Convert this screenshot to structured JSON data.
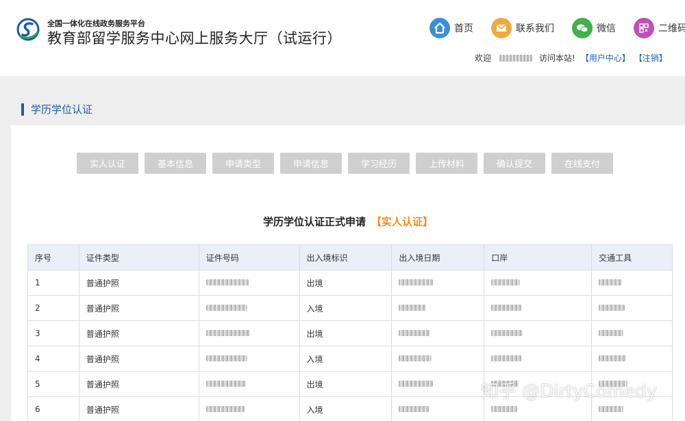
{
  "header": {
    "platform_tag": "全国一体化在线政务服务平台",
    "site_title": "教育部留学服务中心网上服务大厅（试运行）",
    "nav": [
      {
        "label": "首页",
        "icon": "home-icon",
        "color": "#3a8fd6"
      },
      {
        "label": "联系我们",
        "icon": "mail-icon",
        "color": "#f2a93b"
      },
      {
        "label": "微信",
        "icon": "wechat-icon",
        "color": "#3fb24b"
      },
      {
        "label": "二维码",
        "icon": "qrcode-icon",
        "color": "#c44fb6"
      }
    ],
    "welcome_prefix": "欢迎",
    "welcome_suffix": "访问本站!",
    "user_center": "【用户中心】",
    "logout": "【注销】"
  },
  "section": {
    "title": "学历学位认证"
  },
  "steps": [
    "实人认证",
    "基本信息",
    "申请类型",
    "申请信息",
    "学习经历",
    "上传材料",
    "确认提交",
    "在线支付"
  ],
  "form": {
    "heading": "学历学位认证正式申请",
    "current_step": "【实人认证】"
  },
  "table": {
    "columns": [
      "序号",
      "证件类型",
      "证件号码",
      "出入境标识",
      "出入境日期",
      "口岸",
      "交通工具"
    ],
    "rows": [
      {
        "index": "1",
        "doc_type": "普通护照",
        "direction": "出境"
      },
      {
        "index": "2",
        "doc_type": "普通护照",
        "direction": "入境"
      },
      {
        "index": "3",
        "doc_type": "普通护照",
        "direction": "出境"
      },
      {
        "index": "4",
        "doc_type": "普通护照",
        "direction": "入境"
      },
      {
        "index": "5",
        "doc_type": "普通护照",
        "direction": "出境"
      },
      {
        "index": "6",
        "doc_type": "普通护照",
        "direction": "入境"
      }
    ]
  },
  "watermark": "知乎 @DirtyComedy"
}
